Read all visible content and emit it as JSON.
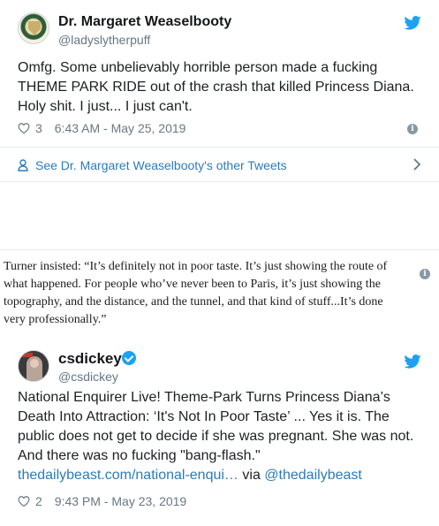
{
  "tweet1": {
    "display_name": "Dr. Margaret Weaselbooty",
    "handle": "@ladyslytherpuff",
    "text": "Omfg. Some unbelievably horrible person made a fucking THEME PARK RIDE out of the crash that killed Princess Diana. Holy shit. I just... I just can't.",
    "likes": "3",
    "timestamp": "6:43 AM - May 25, 2019",
    "other_tweets_label": "See Dr. Margaret Weaselbooty's other Tweets"
  },
  "quote": {
    "text": "Turner insisted: “It’s definitely not in poor taste. It’s just showing the route of what happened. For people who’ve never been to Paris, it’s just showing the topography, and the distance, and the tunnel, and that kind of stuff...It’s done very professionally.”"
  },
  "tweet2": {
    "display_name": "csdickey",
    "handle": "@csdickey",
    "text": "National Enquirer Live! Theme-Park Turns Princess Diana’s Death Into Attraction: ‘It's Not In Poor Taste’ ... Yes it is. The public does not get to decide if she was pregnant. She was not. And there was no fucking \"bang-flash.\"",
    "link": "thedailybeast.com/national-enqui…",
    "via": "via",
    "via_handle": "@thedailybeast",
    "likes": "2",
    "timestamp": "9:43 PM - May 23, 2019"
  },
  "icons": {
    "bird": "twitter-bird-icon",
    "heart": "heart-icon",
    "info": "info-icon",
    "verified": "verified-badge-icon",
    "person": "person-icon",
    "chevron": "chevron-right-icon"
  },
  "colors": {
    "twitter_blue": "#1da1f2",
    "link_blue": "#2b7bb9",
    "meta_gray": "#697882"
  }
}
